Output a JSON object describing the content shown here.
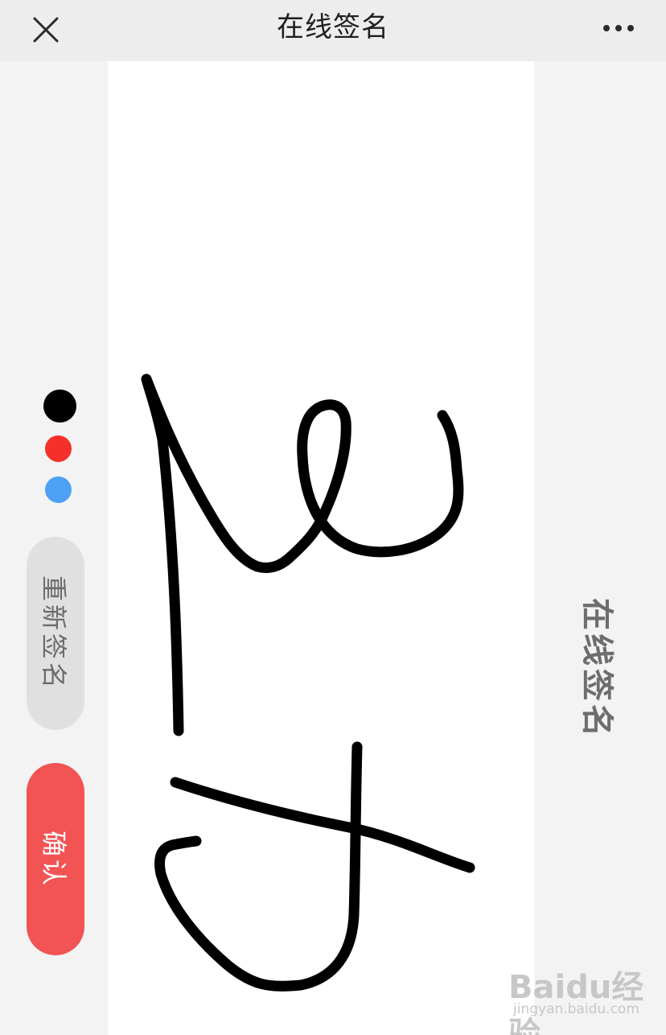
{
  "header": {
    "title": "在线签名",
    "close_icon": "close-icon",
    "more_icon": "more-dots-icon"
  },
  "toolbar": {
    "colors": [
      {
        "name": "black",
        "hex": "#000000"
      },
      {
        "name": "red",
        "hex": "#f5302a"
      },
      {
        "name": "blue",
        "hex": "#4da1f5"
      }
    ],
    "reset_label": "重新签名",
    "confirm_label": "确认"
  },
  "canvas": {
    "ink_color": "#000000",
    "background": "#ffffff"
  },
  "side_title": "在线签名",
  "watermark": {
    "brand": "Baidu经验",
    "url": "jingyan.baidu.com"
  }
}
